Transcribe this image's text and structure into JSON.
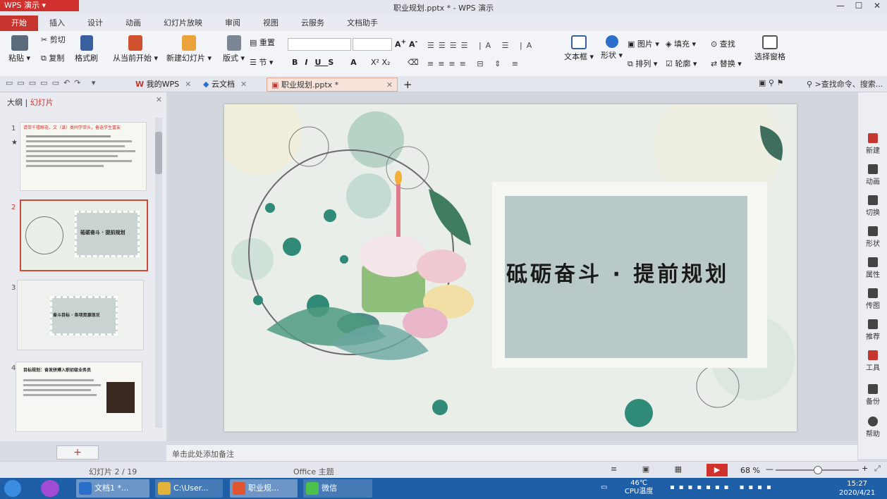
{
  "app": {
    "menu_label": "WPS 演示",
    "title": "职业规划.pptx * - WPS 演示"
  },
  "window_controls": [
    "—",
    "☐",
    "✕"
  ],
  "menu_tabs": [
    "开始",
    "插入",
    "设计",
    "动画",
    "幻灯片放映",
    "审阅",
    "视图",
    "云服务",
    "文档助手"
  ],
  "ribbon": {
    "paste": "粘贴",
    "cut": "剪切",
    "copy": "复制",
    "format_painter": "格式刷",
    "from_current": "从当前开始",
    "new_slide": "新建幻灯片",
    "layout": "版式",
    "reset": "重置",
    "section": "节",
    "text_box": "文本框",
    "shape": "形状",
    "picture": "图片",
    "fill": "填充",
    "arrange": "排列",
    "outline": "轮廓",
    "find": "查找",
    "replace": "替换",
    "select_pane": "选择窗格"
  },
  "doc_tabs": {
    "my_wps": "我的WPS",
    "cloud_docs": "云文档",
    "current": "职业规划.pptx *",
    "add": "+"
  },
  "search": {
    "placeholder": ">查找命令、搜索..."
  },
  "left_panel": {
    "tab_outline": "大纲",
    "tab_slides": "幻灯片",
    "slide_numbers": [
      "1",
      "2",
      "3",
      "4"
    ],
    "thumb1_heading": "请带千禧眼花、文（谋）类同学带头，备选学生富友",
    "thumb2_title": "砥砺奋斗 · 提前规划",
    "thumb3_title": "奋斗目标 · 各项资源现况",
    "thumb4_heading": "目标规划：奋发拼搏入职初级业务员"
  },
  "slide": {
    "title": "砥砺奋斗 · 提前规划"
  },
  "right_sidebar": [
    "新建",
    "动画",
    "切换",
    "形状",
    "属性",
    "传图",
    "推荐",
    "工具",
    "备份",
    "帮助"
  ],
  "notes": {
    "placeholder": "单击此处添加备注"
  },
  "status": {
    "slide_counter": "幻灯片 2 / 19",
    "theme": "Office 主题",
    "zoom": "68 %",
    "zoom_fraction": 0.5
  },
  "taskbar": {
    "items": [
      "文档1 *...",
      "C:\\User...",
      "职业规...",
      "微信"
    ],
    "cpu_temp": "46℃",
    "cpu_label": "CPU温度",
    "time": "15:27",
    "date": "2020/4/21"
  }
}
